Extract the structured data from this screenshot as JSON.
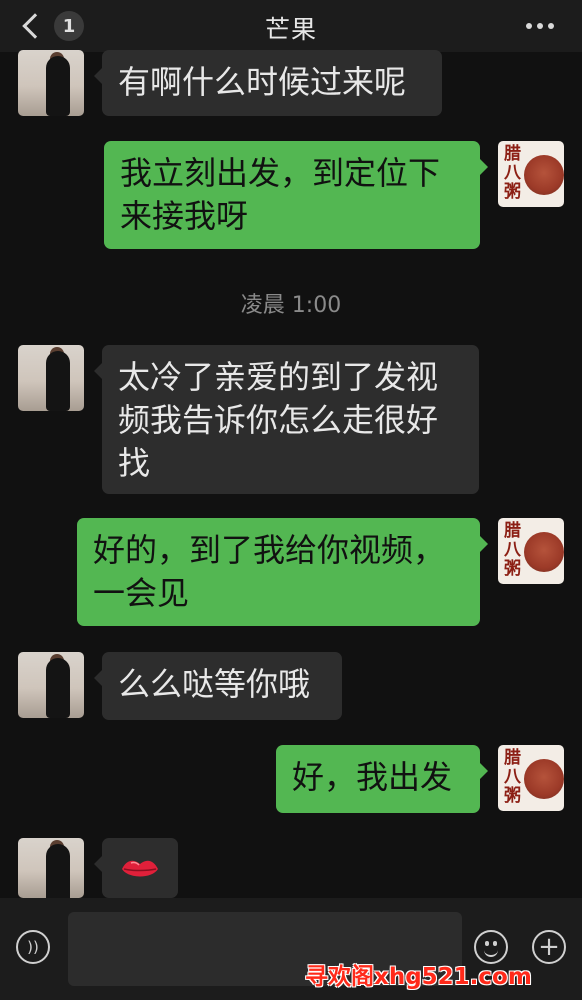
{
  "header": {
    "title": "芒果",
    "unread_count": "1"
  },
  "messages": [
    {
      "side": "in",
      "text": "有啊什么时候过来呢"
    },
    {
      "side": "out",
      "text": "我立刻出发，到定位下来接我呀"
    },
    {
      "side": "in",
      "text": "太冷了亲爱的到了发视频我告诉你怎么走很好找"
    },
    {
      "side": "out",
      "text": "好的，到了我给你视频，一会见"
    },
    {
      "side": "in",
      "text": "么么哒等你哦"
    },
    {
      "side": "out",
      "text": "好，我出发"
    },
    {
      "side": "in",
      "emoji": "lips-emoji"
    }
  ],
  "timestamp": "凌晨 1:00",
  "my_avatar_text": "腊八粥",
  "input": {
    "placeholder": ""
  },
  "watermark": "寻欢阁xhg521.com",
  "colors": {
    "background": "#111111",
    "incoming_bubble": "#2d2d2d",
    "outgoing_bubble": "#53b752",
    "watermark": "#ff2a1a"
  },
  "icons": [
    "back-chevron-icon",
    "more-dots-icon",
    "voice-icon",
    "emoji-icon",
    "plus-icon"
  ]
}
